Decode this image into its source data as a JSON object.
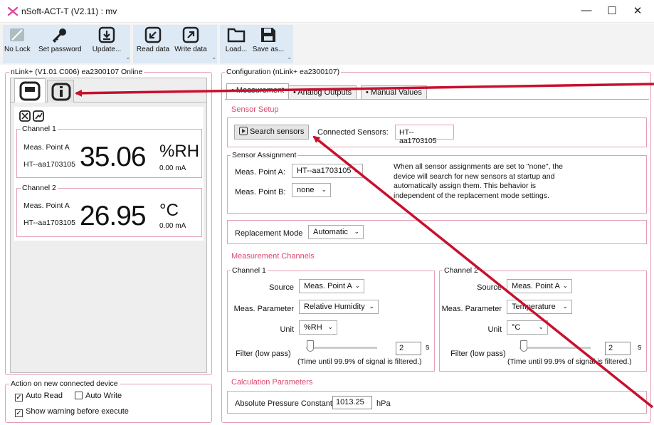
{
  "app": {
    "title": "nSoft-ACT-T (V2.11) : mv",
    "minimize": "—",
    "maximize": "☐",
    "close": "✕"
  },
  "toolbar": {
    "no_lock": "No Lock",
    "set_password": "Set password",
    "update": "Update...",
    "read_data": "Read data",
    "write_data": "Write data",
    "load": "Load...",
    "save_as": "Save as...",
    "expander": "⌄"
  },
  "left": {
    "group_title": "nLink+ (V1.01 C006) ea2300107 Online",
    "channels": [
      {
        "title": "Channel 1",
        "point": "Meas. Point A",
        "sensor": "HT--aa1703105",
        "value": "35.06",
        "unit": "%RH",
        "current": "0.00 mA"
      },
      {
        "title": "Channel 2",
        "point": "Meas. Point A",
        "sensor": "HT--aa1703105",
        "value": "26.95",
        "unit": "°C",
        "current": "0.00 mA"
      }
    ],
    "action": {
      "title": "Action on new connected device",
      "auto_read": "Auto Read",
      "auto_write": "Auto Write",
      "show_warning": "Show warning before execute",
      "check": "✓"
    }
  },
  "config": {
    "title": "Configuration (nLink+ ea2300107)",
    "tabs": [
      "• Measurement",
      "• Analog Outputs",
      "• Manual Values"
    ],
    "sensor_setup": "Sensor Setup",
    "search_button": "Search sensors",
    "connected_label": "Connected Sensors:",
    "connected_value": "HT--aa1703105",
    "assign_title": "Sensor Assignment",
    "point_a_label": "Meas. Point A:",
    "point_a_value": "HT--aa1703105",
    "point_b_label": "Meas. Point B:",
    "point_b_value": "none",
    "assign_note": "When all sensor assignments are set to \"none\", the device will search for new sensors at startup and automatically assign them. This behavior is independent of the replacement mode settings.",
    "replacement_label": "Replacement Mode",
    "replacement_value": "Automatic",
    "channels_head": "Measurement Channels",
    "channels": [
      {
        "title": "Channel 1",
        "source_label": "Source",
        "source": "Meas. Point A",
        "param_label": "Meas. Parameter",
        "param": "Relative Humidity",
        "unit_label": "Unit",
        "unit": "%RH",
        "filter_label": "Filter (low pass)",
        "filter": "2",
        "filter_unit": "s",
        "filter_note": "(Time until 99.9% of signal is filtered.)"
      },
      {
        "title": "Channel 2",
        "source_label": "Source",
        "source": "Meas. Point A",
        "param_label": "Meas. Parameter",
        "param": "Temperature",
        "unit_label": "Unit",
        "unit": "°C",
        "filter_label": "Filter (low pass)",
        "filter": "2",
        "filter_unit": "s",
        "filter_note": "(Time until 99.9% of signal is filtered.)"
      }
    ],
    "calc_head": "Calculation Parameters",
    "pressure_label": "Absolute Pressure Constant",
    "pressure_value": "1013.25",
    "pressure_unit": "hPa"
  },
  "colors": {
    "accent": "#d94a6e",
    "arrow": "#c8102e",
    "toolbar_group": "#dde9f4"
  }
}
